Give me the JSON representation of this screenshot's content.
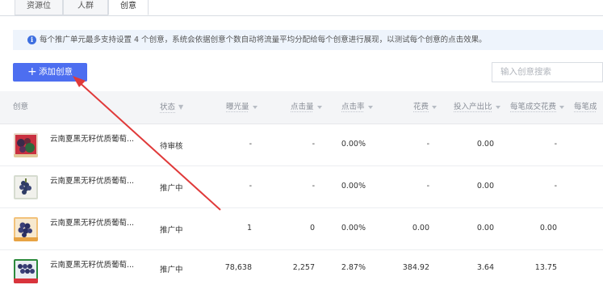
{
  "tabs": [
    {
      "label": "资源位",
      "active": false
    },
    {
      "label": "人群",
      "active": false
    },
    {
      "label": "创意",
      "active": true
    }
  ],
  "info": {
    "text": "每个推广单元最多支持设置 4 个创意，系统会依据创意个数自动将流量平均分配给每个创意进行展现，以测试每个创意的点击效果。"
  },
  "toolbar": {
    "add_label": "添加创意",
    "search_placeholder": "输入创意搜索"
  },
  "table": {
    "columns": [
      "创意",
      "状态",
      "曝光量",
      "点击量",
      "点击率",
      "花费",
      "投入产出比",
      "每笔成交花费",
      "每笔成"
    ],
    "rows": [
      {
        "name": "云南夏黑无籽优质葡萄...",
        "status": "待审核",
        "impressions": "-",
        "clicks": "-",
        "ctr": "0.00%",
        "cost": "-",
        "roi": "0.00",
        "cpa": "-"
      },
      {
        "name": "云南夏黑无籽优质葡萄...",
        "status": "推广中",
        "impressions": "-",
        "clicks": "-",
        "ctr": "0.00%",
        "cost": "-",
        "roi": "0.00",
        "cpa": "-"
      },
      {
        "name": "云南夏黑无籽优质葡萄...",
        "status": "推广中",
        "impressions": "1",
        "clicks": "0",
        "ctr": "0.00%",
        "cost": "0.00",
        "roi": "0.00",
        "cpa": "0.00"
      },
      {
        "name": "云南夏黑无籽优质葡萄...",
        "status": "推广中",
        "impressions": "78,638",
        "clicks": "2,257",
        "ctr": "2.87%",
        "cost": "384.92",
        "roi": "3.64",
        "cpa": "13.75"
      }
    ]
  },
  "colors": {
    "primary": "#4d6ef0",
    "info_bg": "#eef4fc",
    "annotation_arrow": "#e03a3a"
  }
}
